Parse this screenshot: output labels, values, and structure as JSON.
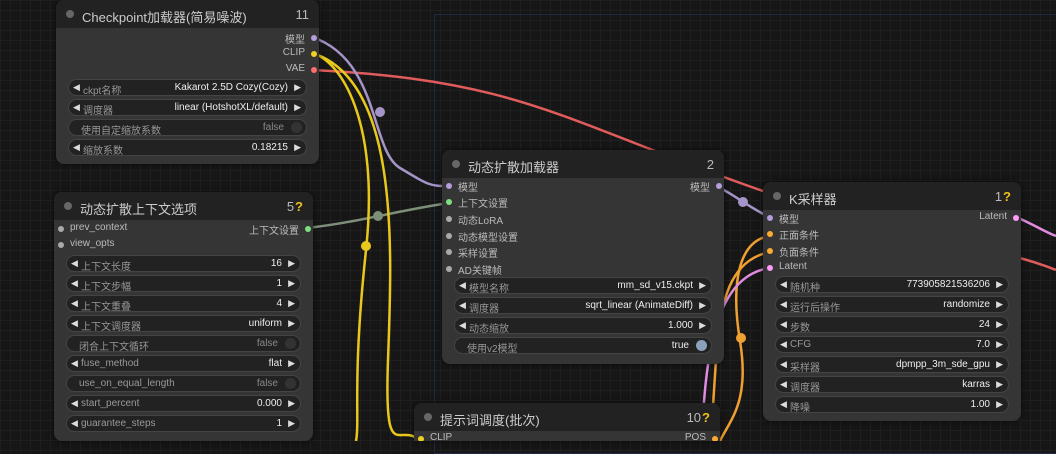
{
  "nodes": {
    "checkpoint": {
      "title": "Checkpoint加载器(简易噪波)",
      "id": "11",
      "badge": "",
      "outputs": [
        "模型",
        "CLIP",
        "VAE"
      ],
      "widgets": [
        {
          "type": "combo",
          "label": "ckpt名称",
          "value": "Kakarot 2.5D Cozy(Cozy)"
        },
        {
          "type": "combo",
          "label": "调度器",
          "value": "linear (HotshotXL/default)"
        },
        {
          "type": "toggle",
          "label": "使用自定缩放系数",
          "value": "false"
        },
        {
          "type": "combo",
          "label": "缩放系数",
          "value": "0.18215"
        }
      ]
    },
    "context": {
      "title": "动态扩散上下文选项",
      "id": "5",
      "badge": "?",
      "inputs": [
        "prev_context",
        "view_opts"
      ],
      "outputs": [
        "上下文设置"
      ],
      "widgets": [
        {
          "type": "combo",
          "label": "上下文长度",
          "value": "16"
        },
        {
          "type": "combo",
          "label": "上下文步幅",
          "value": "1"
        },
        {
          "type": "combo",
          "label": "上下文重叠",
          "value": "4"
        },
        {
          "type": "combo",
          "label": "上下文调度器",
          "value": "uniform"
        },
        {
          "type": "toggle",
          "label": "闭合上下文循环",
          "value": "false"
        },
        {
          "type": "combo",
          "label": "fuse_method",
          "value": "flat"
        },
        {
          "type": "toggle",
          "label": "use_on_equal_length",
          "value": "false"
        },
        {
          "type": "combo",
          "label": "start_percent",
          "value": "0.000"
        },
        {
          "type": "combo",
          "label": "guarantee_steps",
          "value": "1"
        }
      ]
    },
    "animatediff": {
      "title": "动态扩散加载器",
      "id": "2",
      "badge": "",
      "inputs": [
        "模型",
        "上下文设置",
        "动态LoRA",
        "动态模型设置",
        "采样设置",
        "AD关键帧"
      ],
      "outputs": [
        "模型"
      ],
      "widgets": [
        {
          "type": "combo",
          "label": "模型名称",
          "value": "mm_sd_v15.ckpt"
        },
        {
          "type": "combo",
          "label": "调度器",
          "value": "sqrt_linear (AnimateDiff)"
        },
        {
          "type": "combo",
          "label": "动态缩放",
          "value": "1.000"
        },
        {
          "type": "toggle",
          "label": "使用v2模型",
          "value": "true"
        }
      ]
    },
    "ksampler": {
      "title": "K采样器",
      "id": "1",
      "badge": "?",
      "inputs": [
        "模型",
        "正面条件",
        "负面条件",
        "Latent"
      ],
      "outputs": [
        "Latent"
      ],
      "widgets": [
        {
          "type": "combo",
          "label": "随机种",
          "value": "773905821536206"
        },
        {
          "type": "combo",
          "label": "运行后操作",
          "value": "randomize"
        },
        {
          "type": "combo",
          "label": "步数",
          "value": "24"
        },
        {
          "type": "combo",
          "label": "CFG",
          "value": "7.0"
        },
        {
          "type": "combo",
          "label": "采样器",
          "value": "dpmpp_3m_sde_gpu"
        },
        {
          "type": "combo",
          "label": "调度器",
          "value": "karras"
        },
        {
          "type": "combo",
          "label": "降噪",
          "value": "1.00"
        }
      ]
    },
    "prompt": {
      "title": "提示词调度(批次)",
      "id": "10",
      "badge": "?",
      "inputs": [
        "CLIP"
      ],
      "outputs": [
        "POS"
      ]
    }
  },
  "colors": {
    "model": "#b39ddb",
    "clip": "#f0d020",
    "vae": "#ff6e6e",
    "context": "#7fe07f",
    "conditioning": "#ffa931",
    "latent": "#ff9cf9",
    "generic": "#aaaaaa",
    "wire_context": "#7d8f78"
  }
}
